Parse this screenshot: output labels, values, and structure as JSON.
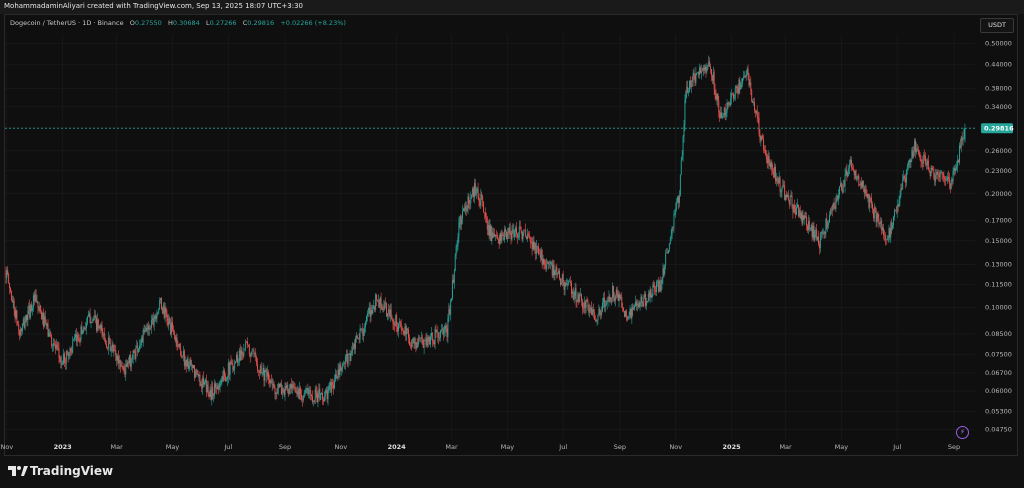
{
  "header": {
    "credit": "MohammadaminAliyari created with TradingView.com, Sep 13, 2025 18:07 UTC+3:30"
  },
  "legend": {
    "symbol": "Dogecoin / TetherUS · 1D · Binance",
    "o_label": "O",
    "o_value": "0.27550",
    "h_label": "H",
    "h_value": "0.30684",
    "l_label": "L",
    "l_value": "0.27266",
    "c_label": "C",
    "c_value": "0.29816",
    "change": "+0.02266 (+8.23%)"
  },
  "currency_button": "USDT",
  "price_badge": "0.29816",
  "brand": "TradingView",
  "colors": {
    "up": "#26a69a",
    "down": "#ef5350",
    "badge": "#26a69a",
    "grid": "#1c1c1e"
  },
  "chart_data": {
    "type": "candlestick",
    "y_scale": "log",
    "y_ticks": [
      "0.50000",
      "0.44000",
      "0.38000",
      "0.34000",
      "0.30000",
      "0.26000",
      "0.23000",
      "0.20000",
      "0.17000",
      "0.15000",
      "0.13000",
      "0.11500",
      "0.10000",
      "0.08500",
      "0.07500",
      "0.06700",
      "0.06000",
      "0.05300",
      "0.04750"
    ],
    "x_ticks": [
      "Nov",
      "2023",
      "Mar",
      "May",
      "Jul",
      "Sep",
      "Nov",
      "2024",
      "Mar",
      "May",
      "Jul",
      "Sep",
      "Nov",
      "2025",
      "Mar",
      "May",
      "Jul",
      "Sep"
    ],
    "last_price": 0.29816,
    "ohlc_last": {
      "open": 0.2755,
      "high": 0.30684,
      "low": 0.27266,
      "close": 0.29816
    },
    "trend_closes": [
      {
        "date": "2022-10-31",
        "close": 0.125
      },
      {
        "date": "2022-11-15",
        "close": 0.085
      },
      {
        "date": "2022-12-01",
        "close": 0.105
      },
      {
        "date": "2022-12-31",
        "close": 0.071
      },
      {
        "date": "2023-02-01",
        "close": 0.095
      },
      {
        "date": "2023-03-10",
        "close": 0.068
      },
      {
        "date": "2023-04-18",
        "close": 0.102
      },
      {
        "date": "2023-05-15",
        "close": 0.072
      },
      {
        "date": "2023-06-12",
        "close": 0.059
      },
      {
        "date": "2023-07-20",
        "close": 0.079
      },
      {
        "date": "2023-08-20",
        "close": 0.061
      },
      {
        "date": "2023-10-15",
        "close": 0.058
      },
      {
        "date": "2023-11-15",
        "close": 0.078
      },
      {
        "date": "2023-12-10",
        "close": 0.105
      },
      {
        "date": "2024-01-20",
        "close": 0.08
      },
      {
        "date": "2024-02-25",
        "close": 0.086
      },
      {
        "date": "2024-03-10",
        "close": 0.17
      },
      {
        "date": "2024-03-28",
        "close": 0.21
      },
      {
        "date": "2024-04-15",
        "close": 0.15
      },
      {
        "date": "2024-05-15",
        "close": 0.16
      },
      {
        "date": "2024-06-20",
        "close": 0.125
      },
      {
        "date": "2024-08-05",
        "close": 0.095
      },
      {
        "date": "2024-08-25",
        "close": 0.11
      },
      {
        "date": "2024-09-10",
        "close": 0.095
      },
      {
        "date": "2024-10-15",
        "close": 0.115
      },
      {
        "date": "2024-11-05",
        "close": 0.2
      },
      {
        "date": "2024-11-12",
        "close": 0.38
      },
      {
        "date": "2024-12-08",
        "close": 0.45
      },
      {
        "date": "2024-12-20",
        "close": 0.32
      },
      {
        "date": "2025-01-18",
        "close": 0.42
      },
      {
        "date": "2025-02-05",
        "close": 0.26
      },
      {
        "date": "2025-02-28",
        "close": 0.2
      },
      {
        "date": "2025-04-07",
        "close": 0.15
      },
      {
        "date": "2025-05-12",
        "close": 0.24
      },
      {
        "date": "2025-06-20",
        "close": 0.15
      },
      {
        "date": "2025-07-20",
        "close": 0.27
      },
      {
        "date": "2025-08-10",
        "close": 0.22
      },
      {
        "date": "2025-08-30",
        "close": 0.215
      },
      {
        "date": "2025-09-13",
        "close": 0.29816
      }
    ]
  }
}
